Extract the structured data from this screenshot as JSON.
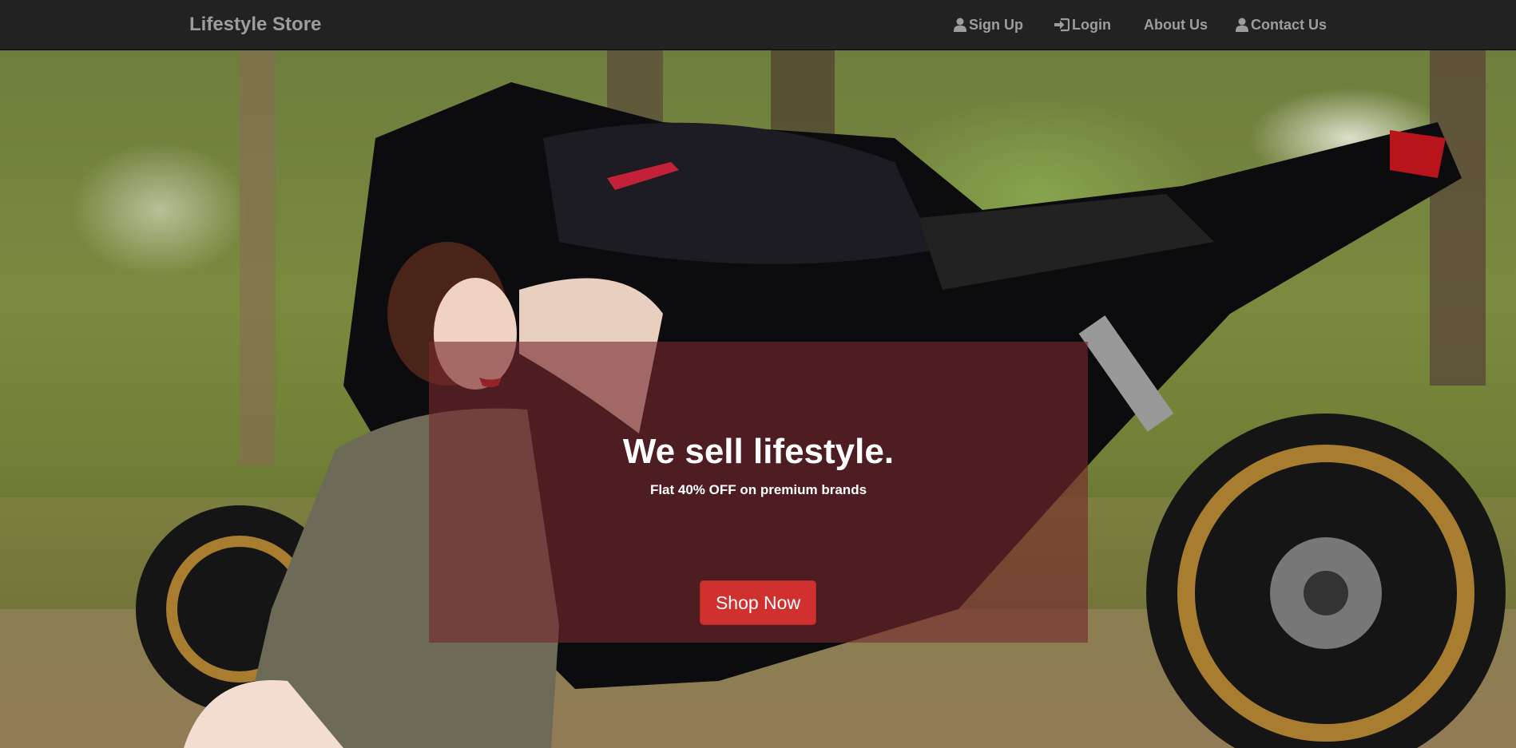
{
  "navbar": {
    "brand": "Lifestyle Store",
    "links": [
      {
        "label": "Sign Up",
        "icon": "user-icon"
      },
      {
        "label": "Login",
        "icon": "log-in-icon"
      },
      {
        "label": "About Us",
        "icon": ""
      },
      {
        "label": "Contact Us",
        "icon": "user-icon"
      }
    ]
  },
  "hero": {
    "headline": "We sell lifestyle.",
    "subline": "Flat 40% OFF on premium brands",
    "cta_label": "Shop Now",
    "background_image": "woman-sitting-beside-black-motorcycle-photo"
  },
  "colors": {
    "navbar_bg": "#222222",
    "nav_text": "#9d9d9d",
    "overlay": "#78282d",
    "cta_bg": "#d0302e"
  }
}
